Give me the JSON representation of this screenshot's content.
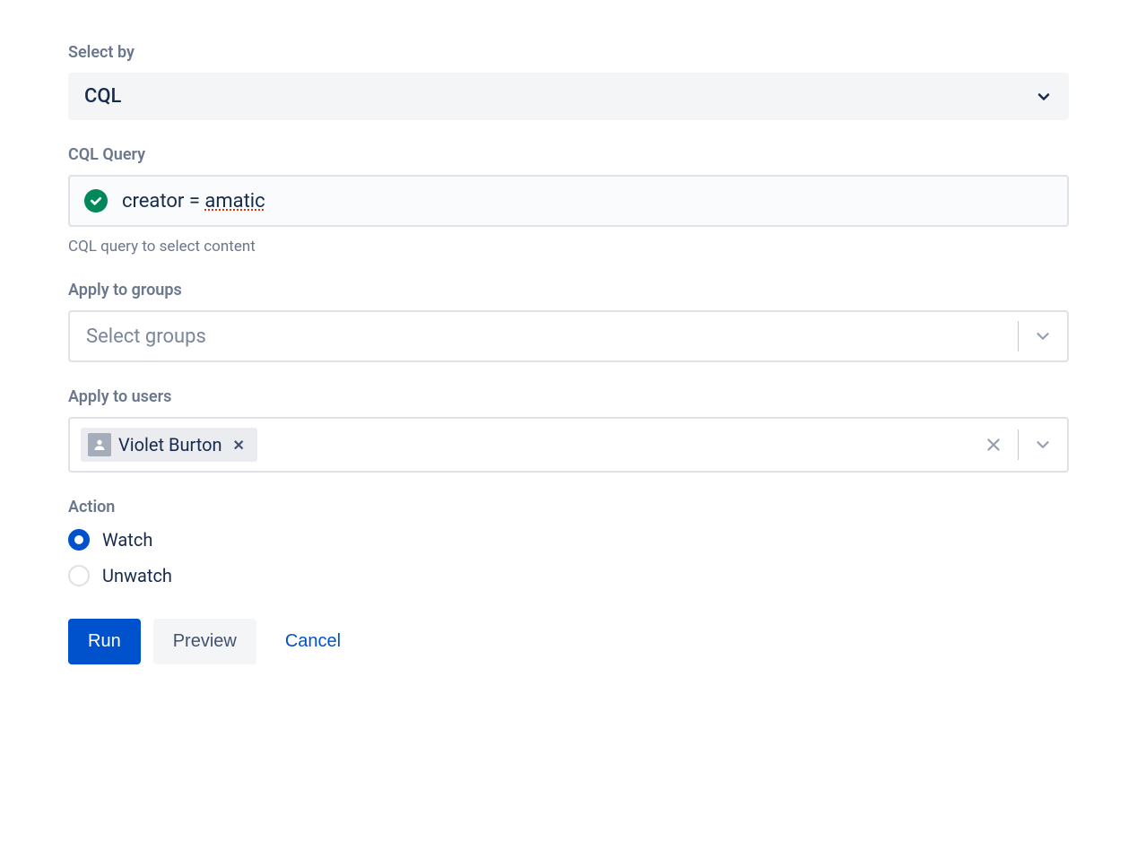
{
  "select_by": {
    "label": "Select by",
    "value": "CQL"
  },
  "cql": {
    "label": "CQL Query",
    "prefix": "creator = ",
    "value_underlined": "amatic",
    "helper": "CQL query to select content"
  },
  "groups": {
    "label": "Apply to groups",
    "placeholder": "Select groups"
  },
  "users": {
    "label": "Apply to users",
    "chips": [
      {
        "name": "Violet Burton"
      }
    ]
  },
  "action": {
    "label": "Action",
    "options": [
      {
        "label": "Watch",
        "checked": true
      },
      {
        "label": "Unwatch",
        "checked": false
      }
    ]
  },
  "buttons": {
    "run": "Run",
    "preview": "Preview",
    "cancel": "Cancel"
  }
}
